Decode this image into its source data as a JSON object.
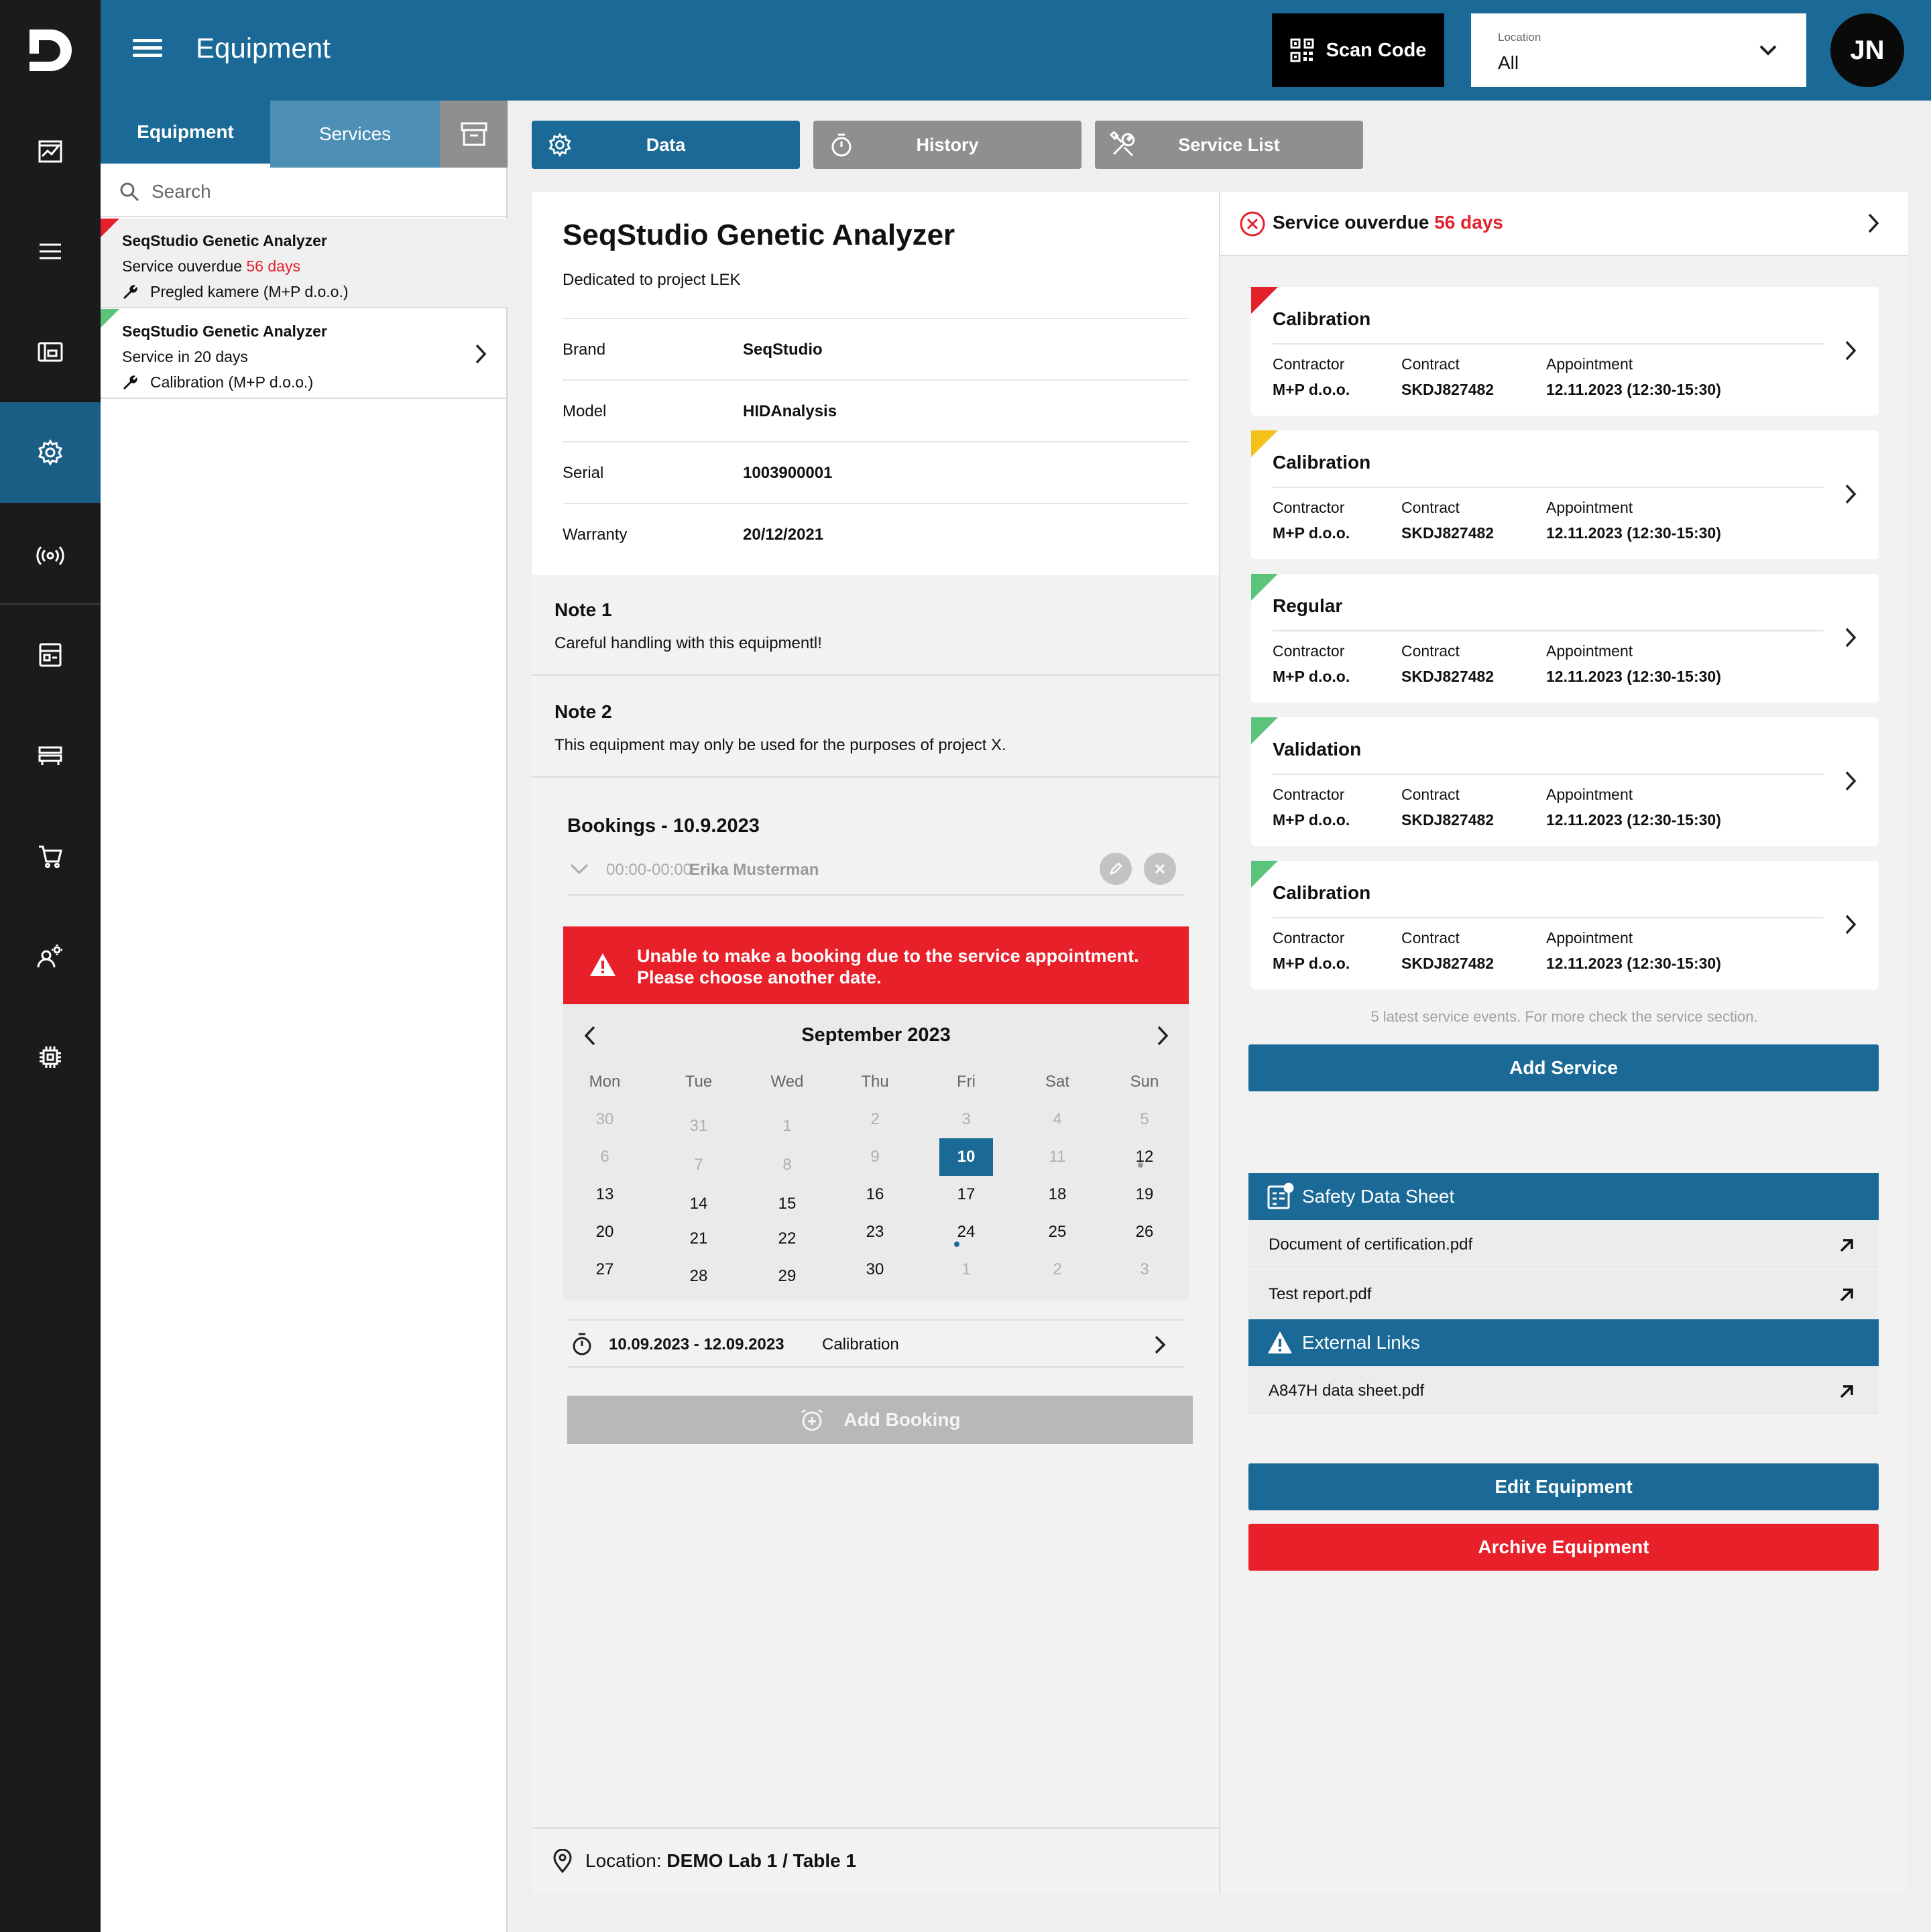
{
  "header": {
    "title": "Equipment",
    "scan_label": "Scan Code",
    "location_label": "Location",
    "location_value": "All",
    "avatar_initials": "JN"
  },
  "rail": {
    "icons": [
      "brand-logo-icon",
      "analytics-icon",
      "list-icon",
      "gallery-icon",
      "equipment-gear-icon",
      "sensor-icon",
      "inventory-icon",
      "storage-icon",
      "cart-icon",
      "user-settings-icon",
      "chip-icon"
    ],
    "active": "equipment-gear-icon"
  },
  "left_panel": {
    "tabs": {
      "equipment": "Equipment",
      "services": "Services"
    },
    "search_placeholder": "Search",
    "items": [
      {
        "name": "SeqStudio Genetic Analyzer",
        "status_prefix": "Service ouverdue ",
        "status_highlight": "56 days",
        "task": "Pregled kamere (M+P d.o.o.)",
        "flag_color": "#e3212b"
      },
      {
        "name": "SeqStudio Genetic Analyzer",
        "status_prefix": "Service in 20 days",
        "status_highlight": "",
        "task": "Calibration (M+P d.o.o.)",
        "flag_color": "#5cc47a"
      }
    ]
  },
  "tabs": {
    "data": "Data",
    "history": "History",
    "service_list": "Service List"
  },
  "equipment": {
    "title": "SeqStudio Genetic Analyzer",
    "description": "Dedicated to project LEK",
    "props": [
      {
        "k": "Brand",
        "v": "SeqStudio"
      },
      {
        "k": "Model",
        "v": "HIDAnalysis"
      },
      {
        "k": "Serial",
        "v": "1003900001"
      },
      {
        "k": "Warranty",
        "v": "20/12/2021"
      }
    ],
    "notes": [
      {
        "title": "Note 1",
        "body": "Careful handling with this equipmentl!"
      },
      {
        "title": "Note 2",
        "body": "This equipment may only be used for the purposes of project X."
      }
    ]
  },
  "bookings": {
    "title": "Bookings - 10.9.2023",
    "row_time": "00:00-00:00",
    "row_person": "Erika Musterman",
    "alert": "Unable to make a booking due to the service appointment.\nPlease choose another date.",
    "calendar": {
      "month": "September 2023",
      "dow": [
        "Mon",
        "Tue",
        "Wed",
        "Thu",
        "Fri",
        "Sat",
        "Sun"
      ],
      "weeks": [
        [
          "30",
          "31",
          "1",
          "2",
          "3",
          "4",
          "5"
        ],
        [
          "6",
          "7",
          "8",
          "9",
          "10",
          "11",
          "12"
        ],
        [
          "13",
          "14",
          "15",
          "16",
          "17",
          "18",
          "19"
        ],
        [
          "20",
          "21",
          "22",
          "23",
          "24",
          "25",
          "26"
        ],
        [
          "27",
          "28",
          "29",
          "30",
          "1",
          "2",
          "3"
        ]
      ],
      "selected": "10"
    },
    "schedule": {
      "date_range": "10.09.2023 - 12.09.2023",
      "type": "Calibration"
    },
    "add_label": "Add Booking"
  },
  "location_footer": {
    "prefix": "Location: ",
    "value": "DEMO Lab 1 / Table 1"
  },
  "service_panel": {
    "head_prefix": "Service ouverdue ",
    "head_highlight": "56 days",
    "col_contractor": "Contractor",
    "col_contract": "Contract",
    "col_appointment": "Appointment",
    "cards": [
      {
        "title": "Calibration",
        "contractor": "M+P d.o.o.",
        "contract": "SKDJ827482",
        "appointment": "12.11.2023 (12:30-15:30)",
        "flag_color": "#e3212b"
      },
      {
        "title": "Calibration",
        "contractor": "M+P d.o.o.",
        "contract": "SKDJ827482",
        "appointment": "12.11.2023 (12:30-15:30)",
        "flag_color": "#f2c21b"
      },
      {
        "title": "Regular",
        "contractor": "M+P d.o.o.",
        "contract": "SKDJ827482",
        "appointment": "12.11.2023 (12:30-15:30)",
        "flag_color": "#5cc47a"
      },
      {
        "title": "Validation",
        "contractor": "M+P d.o.o.",
        "contract": "SKDJ827482",
        "appointment": "12.11.2023 (12:30-15:30)",
        "flag_color": "#5cc47a"
      },
      {
        "title": "Calibration",
        "contractor": "M+P d.o.o.",
        "contract": "SKDJ827482",
        "appointment": "12.11.2023 (12:30-15:30)",
        "flag_color": "#5cc47a"
      }
    ],
    "note": "5 latest service events. For more check the service section.",
    "add_label": "Add Service",
    "sds_title": "Safety Data Sheet",
    "sds_docs": [
      "Document of certification.pdf",
      "Test report.pdf"
    ],
    "links_title": "External Links",
    "links": [
      "A847H data sheet.pdf"
    ],
    "edit_label": "Edit Equipment",
    "archive_label": "Archive Equipment"
  },
  "colors": {
    "primary": "#1a6996",
    "danger": "#e8202a",
    "rail": "#1a1b1c"
  }
}
